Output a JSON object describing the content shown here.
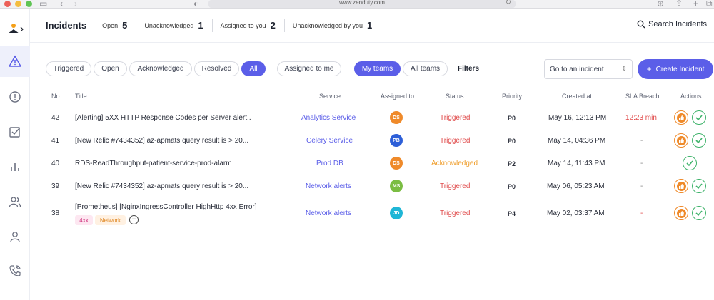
{
  "browser": {
    "url": "www.zenduty.com"
  },
  "header": {
    "title": "Incidents",
    "stats": [
      {
        "label": "Open",
        "value": "5"
      },
      {
        "label": "Unacknowledged",
        "value": "1"
      },
      {
        "label": "Assigned to you",
        "value": "2"
      },
      {
        "label": "Unacknowledged by you",
        "value": "1"
      }
    ],
    "search_label": "Search Incidents"
  },
  "filters": {
    "status_pills": [
      "Triggered",
      "Open",
      "Acknowledged",
      "Resolved",
      "All"
    ],
    "active_status": "All",
    "assigned_pill": "Assigned to me",
    "team_pills": [
      "My teams",
      "All teams"
    ],
    "active_team": "My teams",
    "filters_label": "Filters",
    "goto_placeholder": "Go to an incident",
    "create_label": "Create Incident"
  },
  "table": {
    "columns": [
      "No.",
      "Title",
      "Service",
      "Assigned to",
      "Status",
      "Priority",
      "Created at",
      "SLA Breach",
      "Actions"
    ],
    "rows": [
      {
        "no": "42",
        "title": "[Alerting] 5XX HTTP Response Codes per Server alert..",
        "service": "Analytics Service",
        "assignee": "DS",
        "status": "Triggered",
        "priority": "P0",
        "created": "May 16, 12:13 PM",
        "sla": "12:23 min",
        "tags": []
      },
      {
        "no": "41",
        "title": "[New Relic #7434352] az-apmats query result is > 20...",
        "service": "Celery Service",
        "assignee": "PB",
        "status": "Triggered",
        "priority": "P0",
        "created": "May 14, 04:36 PM",
        "sla": "-",
        "tags": []
      },
      {
        "no": "40",
        "title": "RDS-ReadThroughput-patient-service-prod-alarm",
        "service": "Prod DB",
        "assignee": "DS",
        "status": "Acknowledged",
        "priority": "P2",
        "created": "May 14, 11:43 PM",
        "sla": "-",
        "tags": []
      },
      {
        "no": "39",
        "title": "[New Relic #7434352] az-apmats query result is > 20...",
        "service": "Network alerts",
        "assignee": "MS",
        "status": "Triggered",
        "priority": "P0",
        "created": "May 06, 05:23 AM",
        "sla": "-",
        "tags": []
      },
      {
        "no": "38",
        "title": "[Prometheus] [NginxIngressController HighHttp 4xx Error]",
        "service": "Network alerts",
        "assignee": "JD",
        "status": "Triggered",
        "priority": "P4",
        "created": "May 02, 03:37 AM",
        "sla": "-",
        "tags": [
          "4xx",
          "Network"
        ]
      }
    ]
  },
  "colors": {
    "accent": "#5b5ee8",
    "triggered": "#e04c4c",
    "acknowledged": "#ef9d2a",
    "resolve": "#3fb36b",
    "avatar_DS": "#ef8a2a",
    "avatar_PB": "#2d5fd8",
    "avatar_MS": "#7bbd43",
    "avatar_JD": "#1fb6d6"
  }
}
